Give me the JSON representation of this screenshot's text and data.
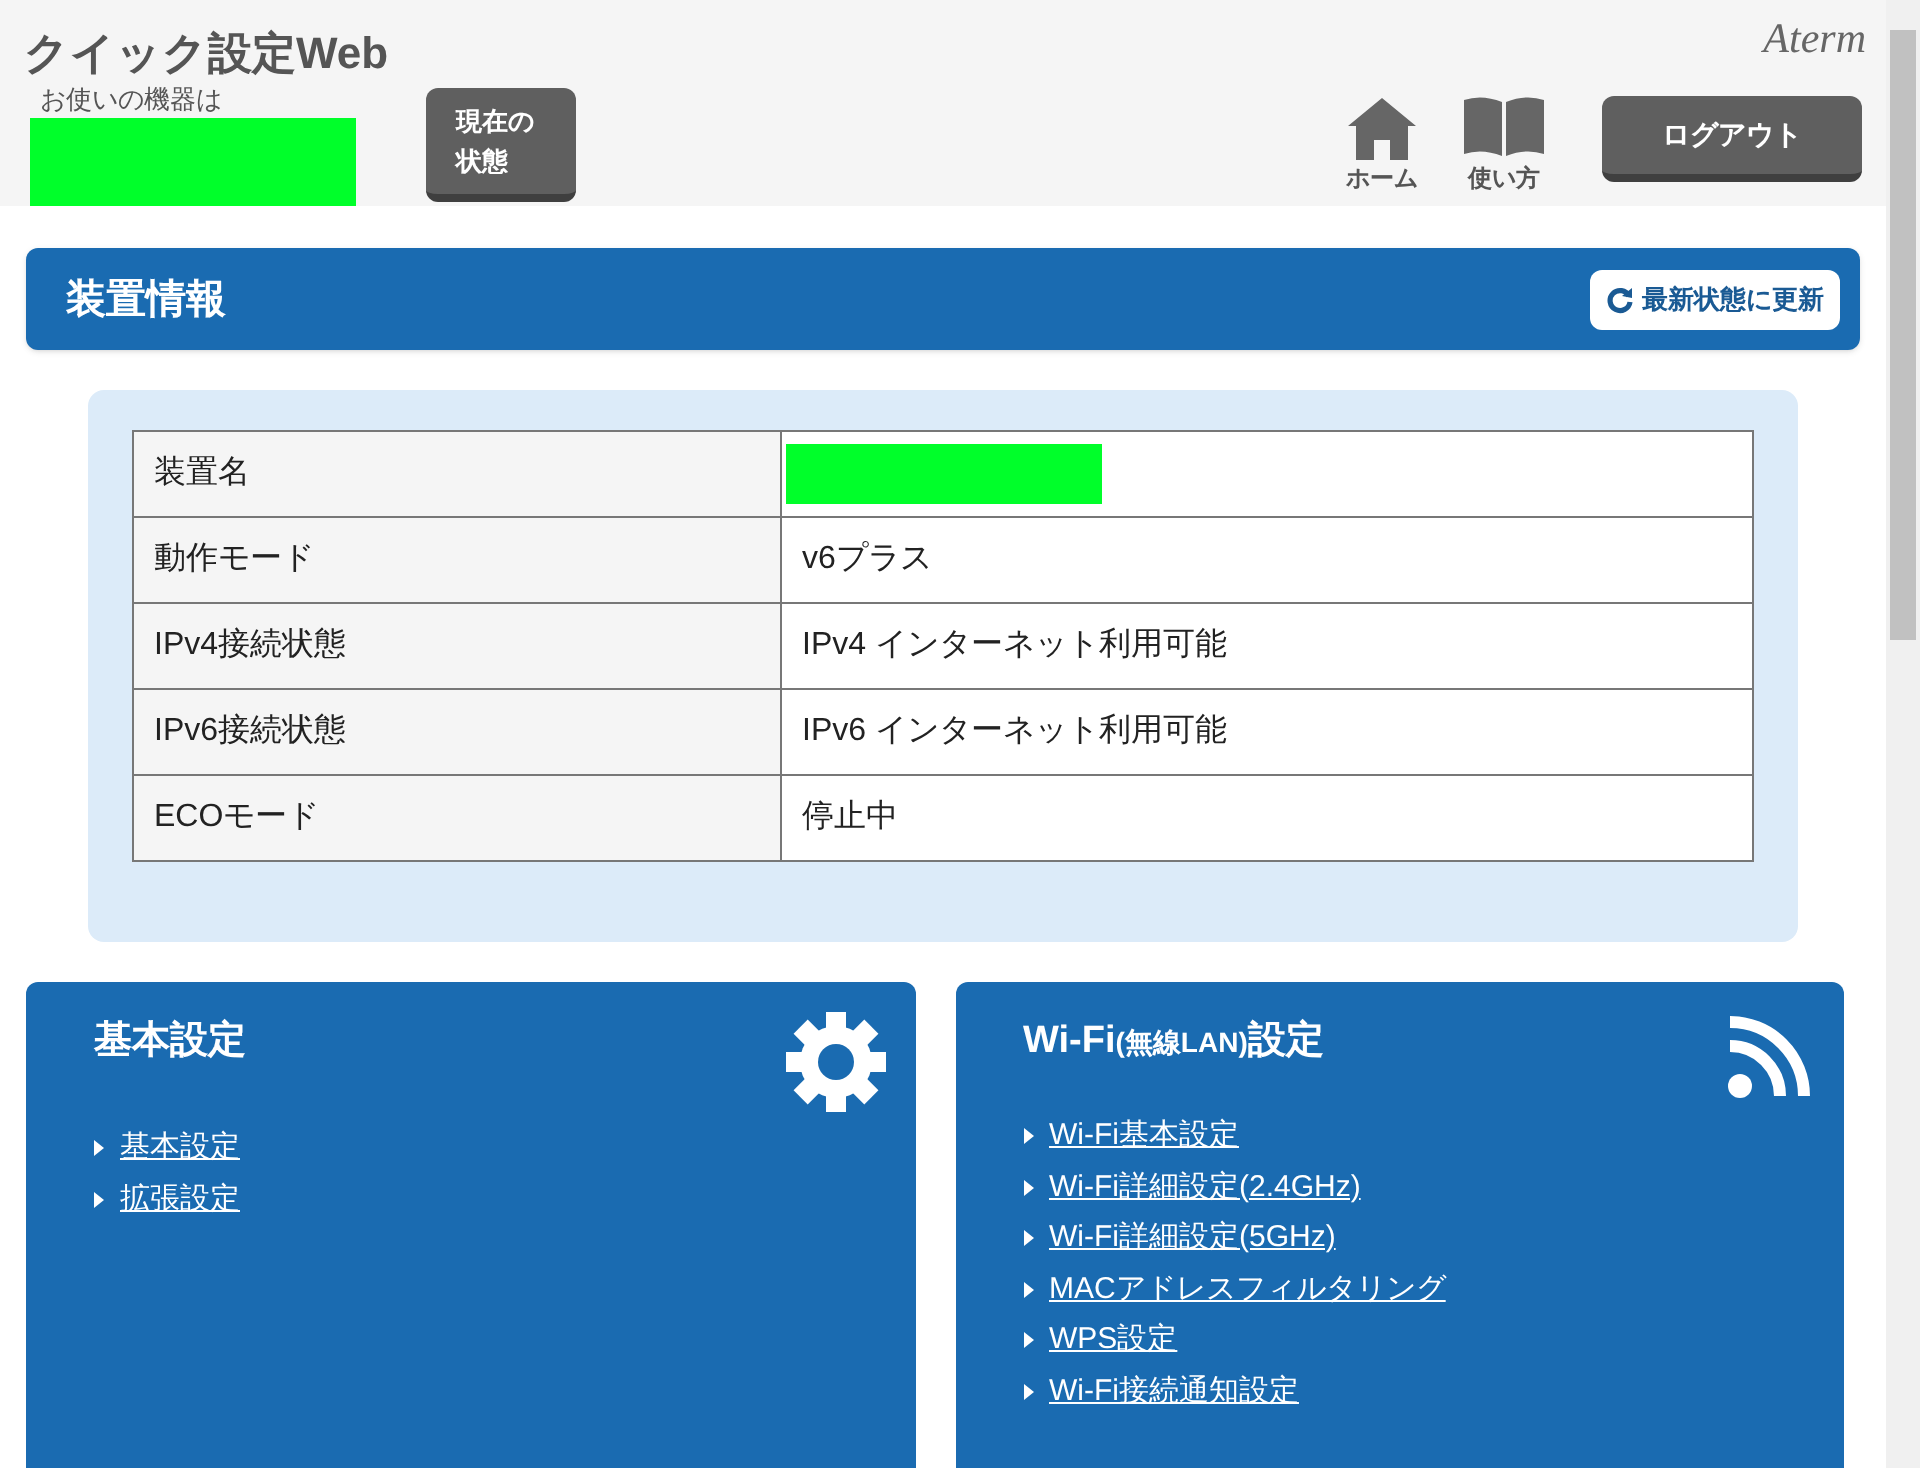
{
  "header": {
    "app_title": "クイック設定Web",
    "device_label": "お使いの機器は",
    "status_button": [
      "現在の",
      "状態"
    ],
    "logo": "Aterm",
    "nav": [
      {
        "kind": "home",
        "label": "ホーム"
      },
      {
        "kind": "book",
        "label": "使い方"
      }
    ],
    "logout_button": "ログアウト"
  },
  "device_info": {
    "title": "装置情報",
    "refresh_button": "最新状態に更新",
    "rows": [
      {
        "label": "装置名",
        "kind": "redacted"
      },
      {
        "label": "動作モード",
        "kind": "text",
        "value": "v6プラス"
      },
      {
        "label": "IPv4接続状態",
        "kind": "text",
        "value": "IPv4 インターネット利用可能"
      },
      {
        "label": "IPv6接続状態",
        "kind": "text",
        "value": "IPv6 インターネット利用可能"
      },
      {
        "label": "ECOモード",
        "kind": "text",
        "value": "停止中"
      }
    ]
  },
  "cards": [
    {
      "kind": "gear",
      "title": [
        {
          "kind": "normal",
          "text": "基本設定"
        }
      ],
      "links": [
        "基本設定",
        "拡張設定"
      ]
    },
    {
      "kind": "wifi",
      "title": [
        {
          "kind": "normal",
          "text": "Wi-Fi"
        },
        {
          "kind": "small",
          "text": "(無線LAN)"
        },
        {
          "kind": "normal",
          "text": "設定"
        }
      ],
      "links": [
        "Wi-Fi基本設定",
        "Wi-Fi詳細設定(2.4GHz)",
        "Wi-Fi詳細設定(5GHz)",
        "MACアドレスフィルタリング",
        "WPS設定",
        "Wi-Fi接続通知設定"
      ]
    }
  ]
}
